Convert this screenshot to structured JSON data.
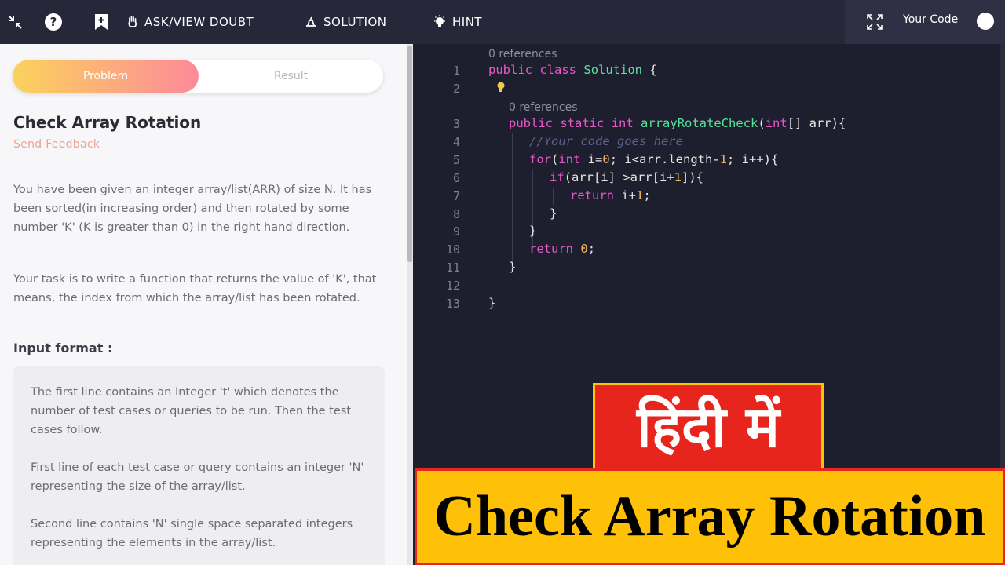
{
  "topbar": {
    "items": [
      {
        "label": "ASK/VIEW DOUBT",
        "icon": "hand-icon"
      },
      {
        "label": "SOLUTION",
        "icon": "solution-icon"
      },
      {
        "label": "HINT",
        "icon": "bulb-icon"
      }
    ],
    "your_code_label": "Your Code"
  },
  "problem": {
    "tabs": {
      "problem": "Problem",
      "result": "Result"
    },
    "title": "Check Array Rotation",
    "feedback": "Send Feedback",
    "paragraph1": "You have been given an integer array/list(ARR) of size N. It has been sorted(in increasing order) and then rotated by some number 'K' (K is greater than 0) in the right hand direction.",
    "paragraph2": "Your task is to write a function that returns the value of 'K', that means, the index from which the array/list has been rotated.",
    "input_heading": "Input format :",
    "input_lines": [
      "The first line contains an Integer 't' which denotes the number of test cases or queries to be run. Then the test cases follow.",
      "First line of each test case or query contains an integer 'N' representing the size of the array/list.",
      "Second line contains 'N' single space separated integers representing the elements in the array/list."
    ]
  },
  "editor": {
    "references_label": "0 references",
    "line_numbers": [
      "1",
      "2",
      "3",
      "4",
      "5",
      "6",
      "7",
      "8",
      "9",
      "10",
      "11",
      "12",
      "13"
    ]
  },
  "overlay": {
    "hindi": "हिंदी में",
    "title": "Check Array Rotation"
  },
  "colors": {
    "topbar_bg": "#262739",
    "editor_bg": "#1e1f2e",
    "keyword": "#e957c9",
    "class_name": "#57e39a",
    "number": "#f2b45e",
    "hindi_bg": "#e8251c",
    "title_bg": "#ffc107"
  }
}
